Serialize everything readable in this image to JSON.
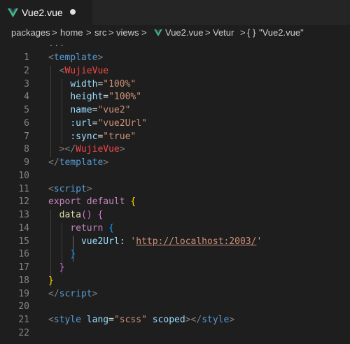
{
  "tab": {
    "label": "Vue2.vue",
    "icon": "vue-logo-icon",
    "dirty": true
  },
  "breadcrumb": {
    "items": [
      "packages",
      "home",
      "src",
      "views",
      "Vue2.vue",
      "Vetur",
      "{ }",
      "\"Vue2.vue\""
    ],
    "separator": ">"
  },
  "editor": {
    "fold_marker": "...",
    "line_numbers": [
      "1",
      "2",
      "3",
      "4",
      "5",
      "6",
      "7",
      "8",
      "9",
      "10",
      "11",
      "12",
      "13",
      "14",
      "15",
      "16",
      "17",
      "18",
      "19",
      "20",
      "21",
      "22"
    ],
    "lines": [
      [
        [
          "t-bracket",
          "<"
        ],
        [
          "t-tag",
          "template"
        ],
        [
          "t-bracket",
          ">"
        ]
      ],
      [
        [
          "t-plain",
          "  "
        ],
        [
          "t-bracket",
          "<"
        ],
        [
          "t-comp",
          "WujieVue"
        ]
      ],
      [
        [
          "t-plain",
          "    "
        ],
        [
          "t-attr",
          "width"
        ],
        [
          "t-plain",
          "="
        ],
        [
          "t-str",
          "\"100%\""
        ]
      ],
      [
        [
          "t-plain",
          "    "
        ],
        [
          "t-attr",
          "height"
        ],
        [
          "t-plain",
          "="
        ],
        [
          "t-str",
          "\"100%\""
        ]
      ],
      [
        [
          "t-plain",
          "    "
        ],
        [
          "t-attr",
          "name"
        ],
        [
          "t-plain",
          "="
        ],
        [
          "t-str",
          "\"vue2\""
        ]
      ],
      [
        [
          "t-plain",
          "    "
        ],
        [
          "t-attr",
          ":url"
        ],
        [
          "t-plain",
          "="
        ],
        [
          "t-str",
          "\"vue2Url\""
        ]
      ],
      [
        [
          "t-plain",
          "    "
        ],
        [
          "t-attr",
          ":sync"
        ],
        [
          "t-plain",
          "="
        ],
        [
          "t-str",
          "\"true\""
        ]
      ],
      [
        [
          "t-plain",
          "  "
        ],
        [
          "t-bracket",
          "></"
        ],
        [
          "t-comp",
          "WujieVue"
        ],
        [
          "t-bracket",
          ">"
        ]
      ],
      [
        [
          "t-bracket",
          "</"
        ],
        [
          "t-tag",
          "template"
        ],
        [
          "t-bracket",
          ">"
        ]
      ],
      [],
      [
        [
          "t-bracket",
          "<"
        ],
        [
          "t-tag",
          "script"
        ],
        [
          "t-bracket",
          ">"
        ]
      ],
      [
        [
          "t-kw",
          "export"
        ],
        [
          "t-plain",
          " "
        ],
        [
          "t-kw",
          "default"
        ],
        [
          "t-plain",
          " "
        ],
        [
          "t-br1",
          "{"
        ]
      ],
      [
        [
          "t-plain",
          "  "
        ],
        [
          "t-fn",
          "data"
        ],
        [
          "t-br2",
          "()"
        ],
        [
          "t-plain",
          " "
        ],
        [
          "t-br2",
          "{"
        ]
      ],
      [
        [
          "t-plain",
          "    "
        ],
        [
          "t-kw",
          "return"
        ],
        [
          "t-plain",
          " "
        ],
        [
          "t-br3",
          "{"
        ]
      ],
      [
        [
          "t-plain",
          "      "
        ],
        [
          "t-prop",
          "vue2Url"
        ],
        [
          "t-plain",
          ": "
        ],
        [
          "t-str",
          "'"
        ],
        [
          "t-url",
          "http://localhost:2003/"
        ],
        [
          "t-str",
          "'"
        ]
      ],
      [
        [
          "t-plain",
          "    "
        ],
        [
          "t-br3",
          "}"
        ]
      ],
      [
        [
          "t-plain",
          "  "
        ],
        [
          "t-br2",
          "}"
        ]
      ],
      [
        [
          "t-br1",
          "}"
        ]
      ],
      [
        [
          "t-bracket",
          "</"
        ],
        [
          "t-tag",
          "script"
        ],
        [
          "t-bracket",
          ">"
        ]
      ],
      [],
      [
        [
          "t-bracket",
          "<"
        ],
        [
          "t-tag",
          "style"
        ],
        [
          "t-plain",
          " "
        ],
        [
          "t-attr",
          "lang"
        ],
        [
          "t-plain",
          "="
        ],
        [
          "t-str",
          "\"scss\""
        ],
        [
          "t-plain",
          " "
        ],
        [
          "t-attr",
          "scoped"
        ],
        [
          "t-bracket",
          "></"
        ],
        [
          "t-tag",
          "style"
        ],
        [
          "t-bracket",
          ">"
        ]
      ],
      []
    ]
  },
  "colors": {
    "background": "#1e1e1e",
    "tab_bar": "#252526",
    "vue_green": "#41b883",
    "vue_dark": "#34495e"
  }
}
